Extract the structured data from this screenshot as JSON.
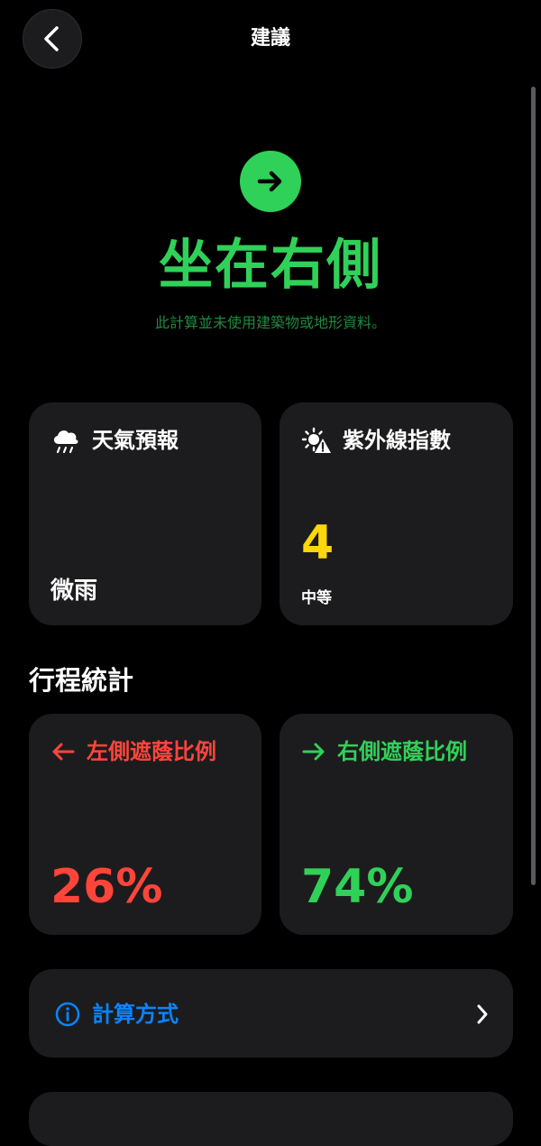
{
  "nav": {
    "title": "建議"
  },
  "recommendation": {
    "title": "坐在右側",
    "note": "此計算並未使用建築物或地形資料。",
    "accent_color": "#30d158",
    "icon": "arrow-right-circle-icon"
  },
  "weather": {
    "label": "天氣預報",
    "value": "微雨",
    "icon": "cloud-rain-icon"
  },
  "uv": {
    "label": "紫外線指數",
    "value": "4",
    "level": "中等",
    "value_color": "#ffd60a",
    "icon": "sun-warning-icon"
  },
  "trip_stats": {
    "title": "行程統計",
    "left": {
      "label": "左側遮蔭比例",
      "percent": "26%",
      "color": "#ff453a"
    },
    "right": {
      "label": "右側遮蔭比例",
      "percent": "74%",
      "color": "#30d158"
    }
  },
  "calc_method": {
    "label": "計算方式",
    "color": "#0a84ff"
  }
}
